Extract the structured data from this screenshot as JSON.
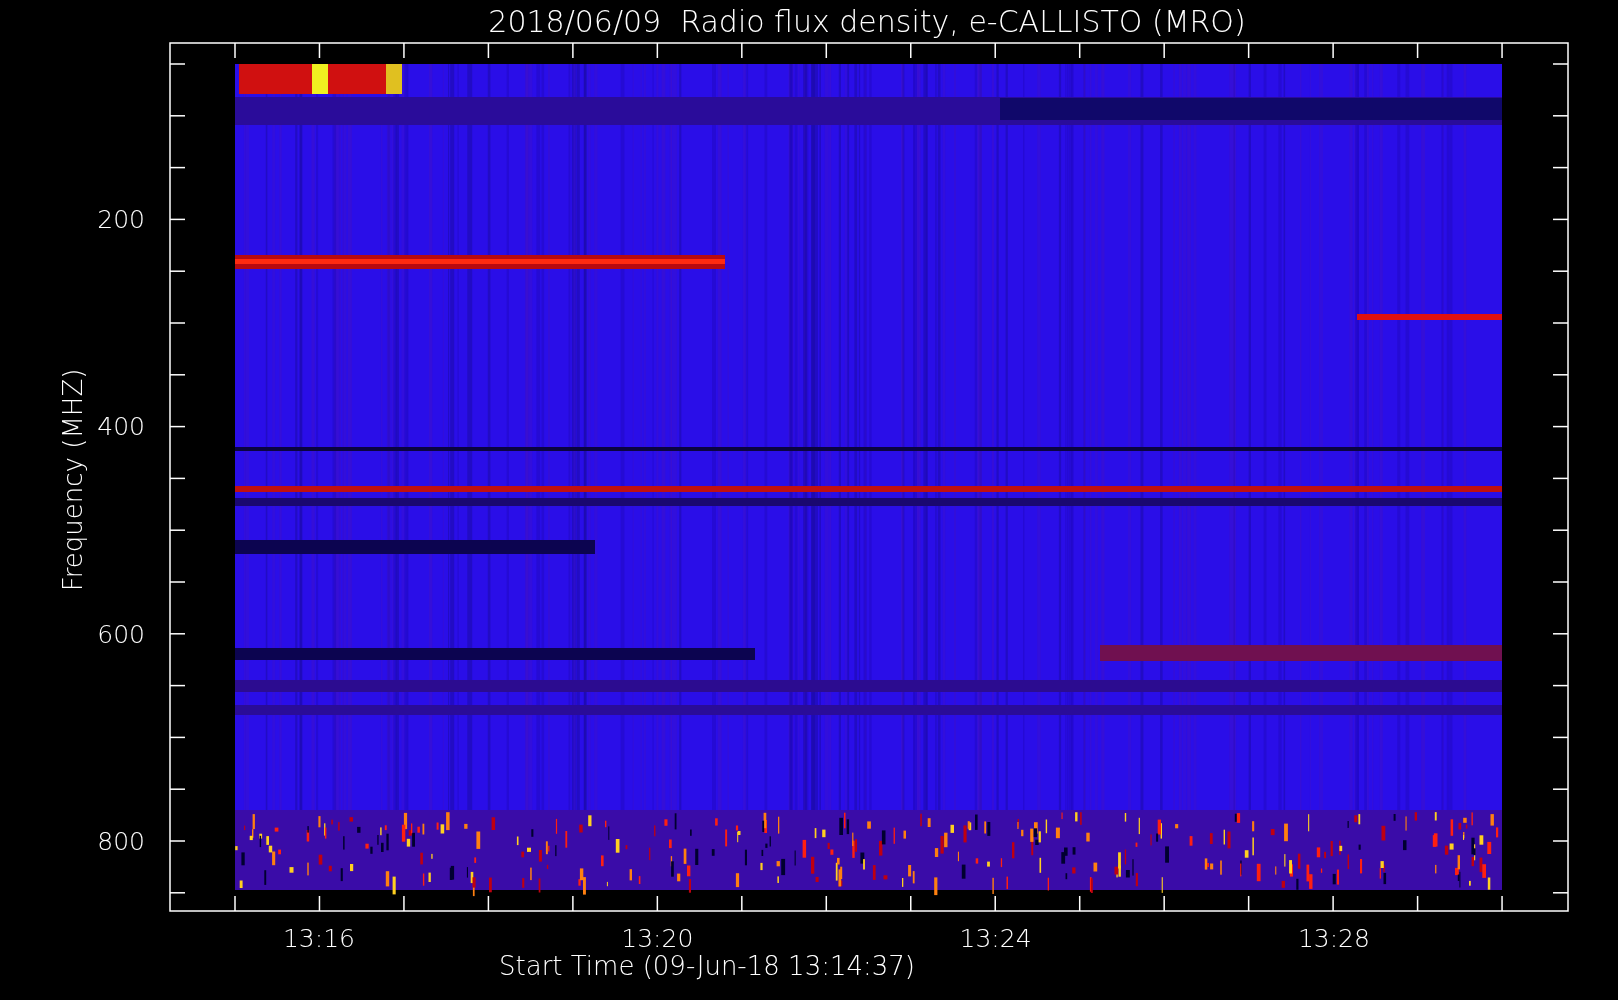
{
  "title": "2018/06/09  Radio flux density, e-CALLISTO (MRO)",
  "xlabel": "Start Time (09-Jun-18 13:14:37)",
  "ylabel": "Frequency (MHZ)",
  "xticks": [
    "13:16",
    "13:20",
    "13:24",
    "13:28"
  ],
  "yticks": [
    "200",
    "400",
    "600",
    "800"
  ]
}
